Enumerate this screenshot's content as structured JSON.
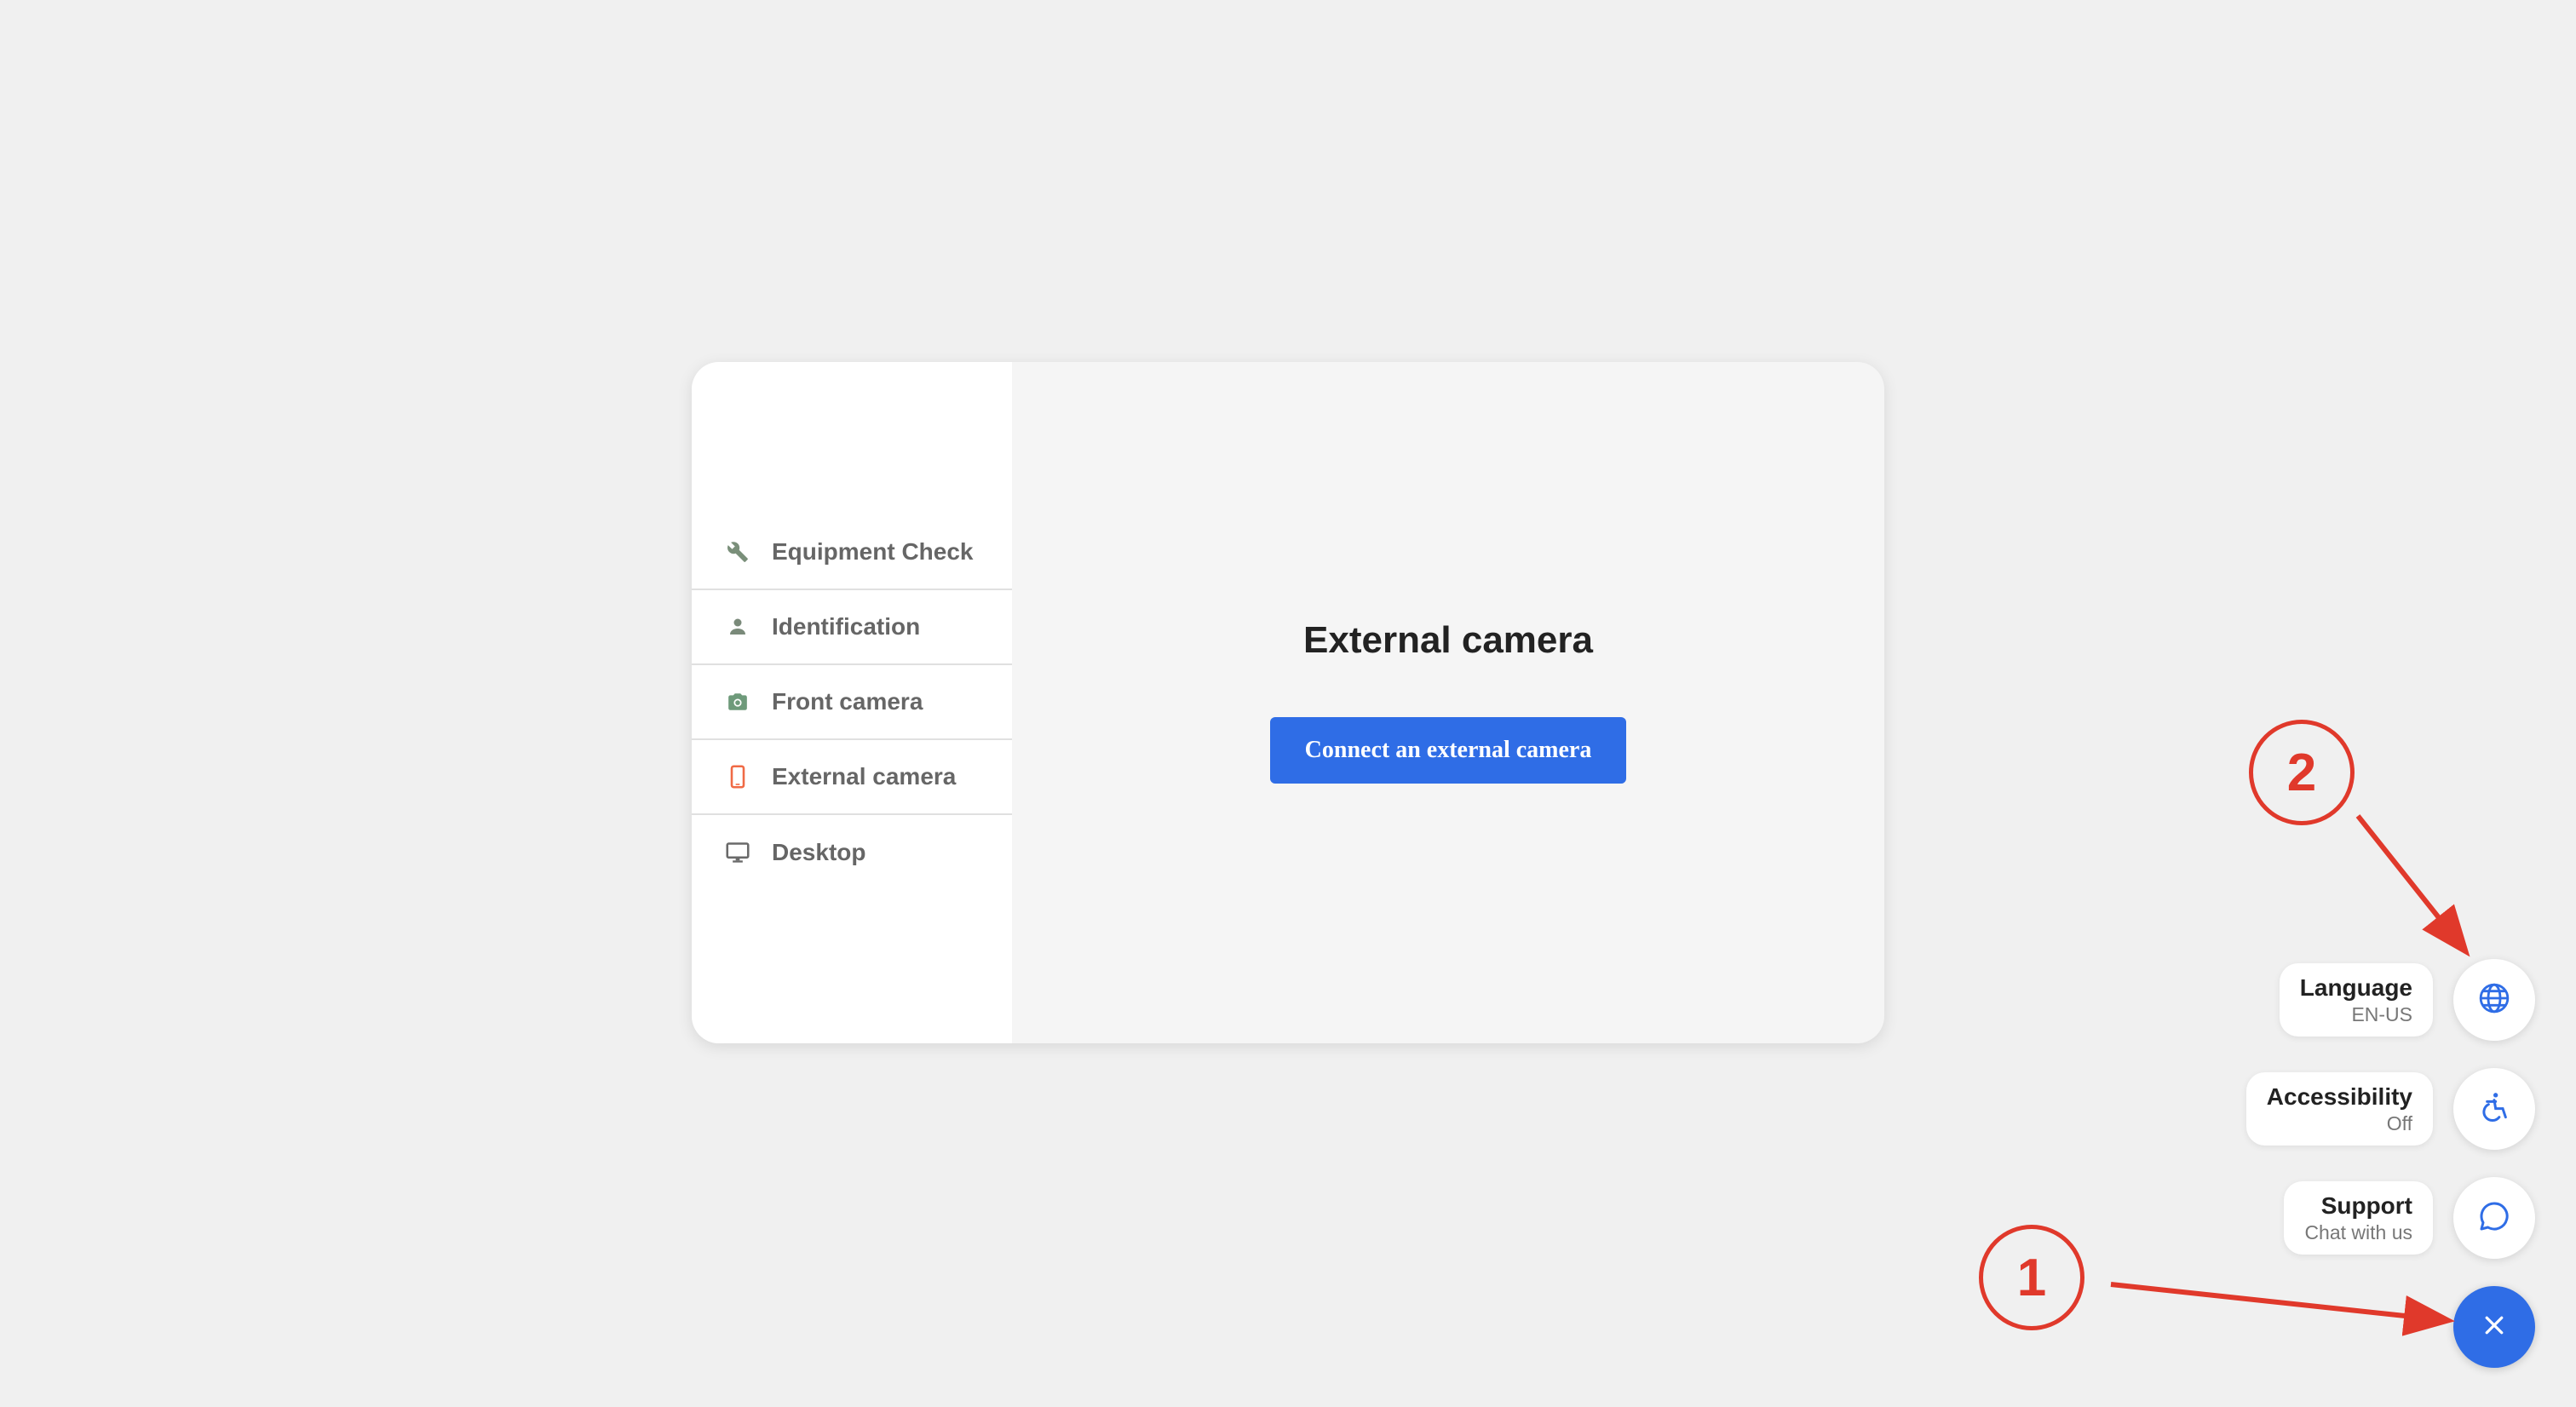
{
  "sidebar": {
    "items": [
      {
        "label": "Equipment Check",
        "icon": "wrench-icon",
        "icon_color": "#7a8f7a"
      },
      {
        "label": "Identification",
        "icon": "person-icon",
        "icon_color": "#7a8a7a"
      },
      {
        "label": "Front camera",
        "icon": "camera-icon",
        "icon_color": "#6e9a7a"
      },
      {
        "label": "External camera",
        "icon": "mobile-phone-icon",
        "icon_color": "#f06a45"
      },
      {
        "label": "Desktop",
        "icon": "monitor-icon",
        "icon_color": "#6a6a6a"
      }
    ]
  },
  "main": {
    "title": "External camera",
    "connect_button": "Connect an external camera"
  },
  "fab_menu": {
    "language": {
      "title": "Language",
      "value": "EN-US",
      "icon": "globe-icon"
    },
    "accessibility": {
      "title": "Accessibility",
      "value": "Off",
      "icon": "accessibility-icon"
    },
    "support": {
      "title": "Support",
      "value": "Chat with us",
      "icon": "chat-bubble-icon"
    },
    "close_icon": "close-icon"
  },
  "annotations": {
    "callout_1": "1",
    "callout_2": "2",
    "color": "#e0392b"
  },
  "colors": {
    "accent": "#2f6de6",
    "background": "#f0f0f0"
  }
}
